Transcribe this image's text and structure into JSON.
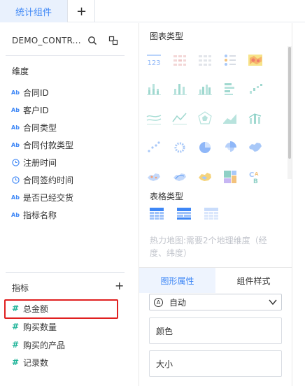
{
  "tabs": {
    "active_label": "统计组件",
    "add_label": "+"
  },
  "dataset": {
    "name": "DEMO_CONTR..."
  },
  "dimensions": {
    "header": "维度",
    "fields": [
      {
        "icon": "text-field-icon",
        "badge": "Ab",
        "label": "合同ID"
      },
      {
        "icon": "text-field-icon",
        "badge": "Ab",
        "label": "客户ID"
      },
      {
        "icon": "text-field-icon",
        "badge": "Ab",
        "label": "合同类型"
      },
      {
        "icon": "text-field-icon",
        "badge": "Ab",
        "label": "合同付款类型"
      },
      {
        "icon": "clock-icon",
        "badge": "",
        "label": "注册时间"
      },
      {
        "icon": "clock-icon",
        "badge": "",
        "label": "合同签约时间"
      },
      {
        "icon": "text-field-icon",
        "badge": "Ab",
        "label": "是否已经交货"
      },
      {
        "icon": "text-field-icon",
        "badge": "Ab",
        "label": "指标名称"
      }
    ]
  },
  "measures": {
    "header": "指标",
    "add_label": "+",
    "fields": [
      {
        "icon": "number-field-icon",
        "badge": "#",
        "label": "总金额"
      },
      {
        "icon": "number-field-icon",
        "badge": "#",
        "label": "购买数量"
      },
      {
        "icon": "number-field-icon",
        "badge": "#",
        "label": "购买的产品"
      },
      {
        "icon": "number-field-icon",
        "badge": "#",
        "label": "记录数"
      }
    ]
  },
  "chart_types": {
    "header": "图表类型",
    "kpi_text": "123"
  },
  "table_types": {
    "header": "表格类型"
  },
  "hint": "热力地图:需要2个地理维度（经度、纬度）",
  "properties": {
    "tab_chart": "图形属性",
    "tab_style": "组件样式",
    "mode_icon": "A",
    "mode_value": "自动",
    "color_label": "颜色",
    "size_label": "大小"
  },
  "colors": {
    "accent": "#3e87f6",
    "measure": "#22b59a",
    "highlight": "#e02020"
  }
}
